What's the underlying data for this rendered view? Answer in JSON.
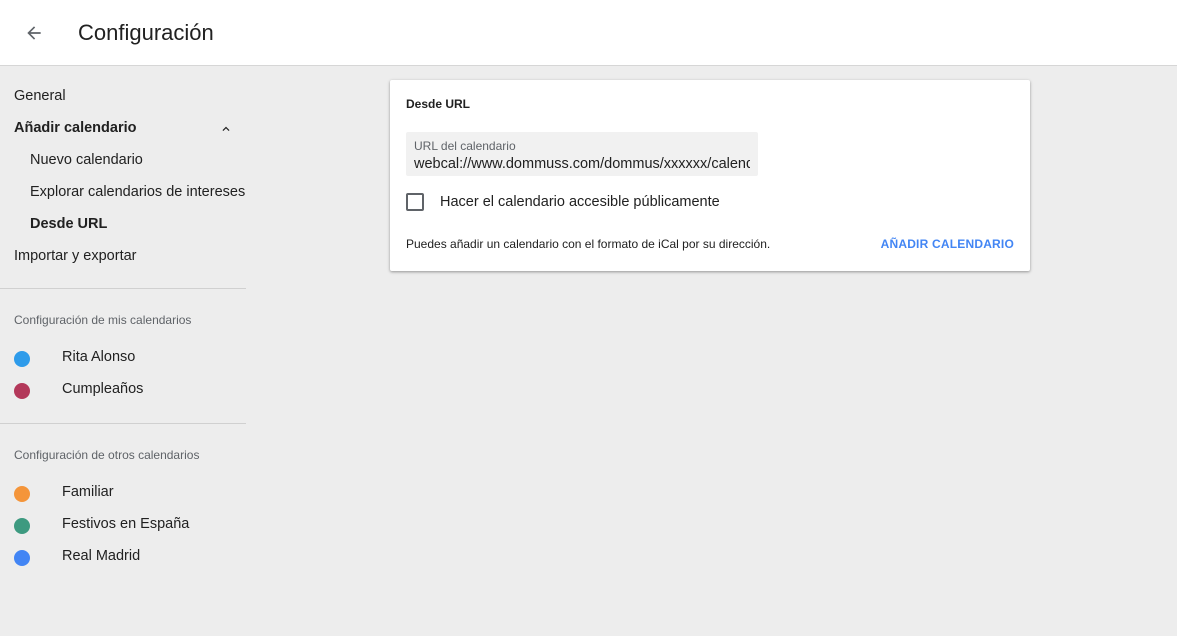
{
  "header": {
    "title": "Configuración",
    "back_icon": "arrow-back-icon"
  },
  "sidebar": {
    "general": "General",
    "add_calendar": "Añadir calendario",
    "add_calendar_subitems": [
      "Nuevo calendario",
      "Explorar calendarios de intereses",
      "Desde URL"
    ],
    "import_export": "Importar y exportar",
    "my_calendars_label": "Configuración de mis calendarios",
    "my_calendars": [
      {
        "name": "Rita Alonso",
        "color": "#2e9bea"
      },
      {
        "name": "Cumpleaños",
        "color": "#b3385a"
      }
    ],
    "other_calendars_label": "Configuración de otros calendarios",
    "other_calendars": [
      {
        "name": "Familiar",
        "color": "#f4953a"
      },
      {
        "name": "Festivos en España",
        "color": "#3d9a80"
      },
      {
        "name": "Real Madrid",
        "color": "#4285f4"
      }
    ]
  },
  "card": {
    "title": "Desde URL",
    "url_field_label": "URL del calendario",
    "url_field_value": "webcal://www.dommuss.com/dommus/xxxxxx/calendario",
    "public_checkbox_label": "Hacer el calendario accesible públicamente",
    "public_checked": false,
    "hint": "Puedes añadir un calendario con el formato de iCal por su dirección.",
    "add_button_label": "AÑADIR CALENDARIO"
  },
  "colors": {
    "accent": "#4285f4",
    "background": "#ededed"
  }
}
